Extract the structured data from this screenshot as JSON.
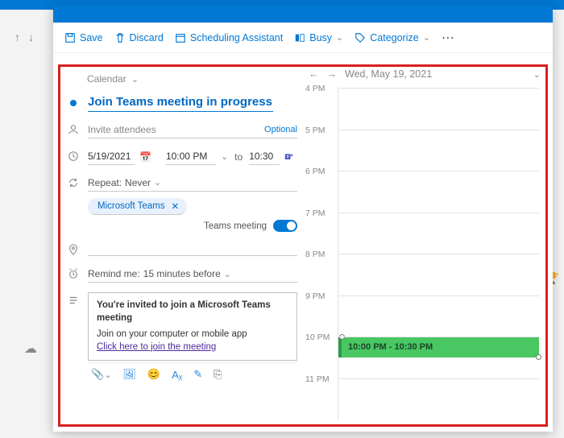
{
  "toolbar": {
    "save": "Save",
    "discard": "Discard",
    "scheduling": "Scheduling Assistant",
    "busy": "Busy",
    "categorize": "Categorize"
  },
  "form": {
    "calendar_label": "Calendar",
    "title": "Join Teams meeting in progress",
    "attendees_placeholder": "Invite attendees",
    "optional_label": "Optional",
    "date": "5/19/2021",
    "start_time": "10:00 PM",
    "to_label": "to",
    "end_time": "10:30",
    "repeat_prefix": "Repeat:",
    "repeat_value": "Never",
    "chip_label": "Microsoft Teams",
    "teams_toggle_label": "Teams meeting",
    "teams_toggle_on": true,
    "remind_prefix": "Remind me:",
    "remind_value": "15 minutes before",
    "body": {
      "heading": "You're invited to join a Microsoft Teams meeting",
      "line1": "Join on your computer or mobile app",
      "link": "Click here to join the meeting"
    }
  },
  "schedule": {
    "date_label": "Wed, May 19, 2021",
    "hours": [
      "4 PM",
      "5 PM",
      "6 PM",
      "7 PM",
      "8 PM",
      "9 PM",
      "10 PM",
      "11 PM"
    ],
    "event_label": "10:00 PM - 10:30 PM",
    "event_start_hour_index": 6,
    "event_duration_halfslots": 1
  }
}
